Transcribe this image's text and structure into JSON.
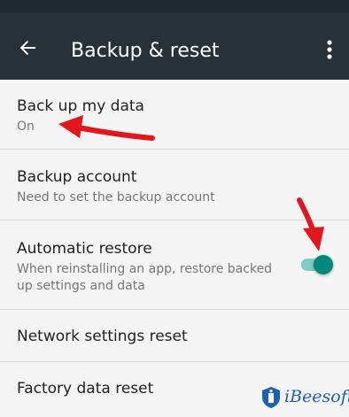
{
  "toolbar": {
    "title": "Backup & reset",
    "back_icon": "arrow-back-icon",
    "overflow_icon": "more-vert-icon",
    "background_color": "#263238"
  },
  "settings": [
    {
      "title": "Back up my data",
      "subtitle": "On"
    },
    {
      "title": "Backup account",
      "subtitle": "Need to set the backup account"
    },
    {
      "title": "Automatic restore",
      "subtitle": "When reinstalling an app, restore backed up settings and data",
      "toggle_on": true
    },
    {
      "title": "Network settings reset"
    },
    {
      "title": "Factory data reset"
    }
  ],
  "colors": {
    "accent": "#00897b",
    "annotation_arrow": "#e3161b"
  },
  "watermark": {
    "text": "iBeesoft",
    "icon": "ibeesoft-logo-icon"
  }
}
